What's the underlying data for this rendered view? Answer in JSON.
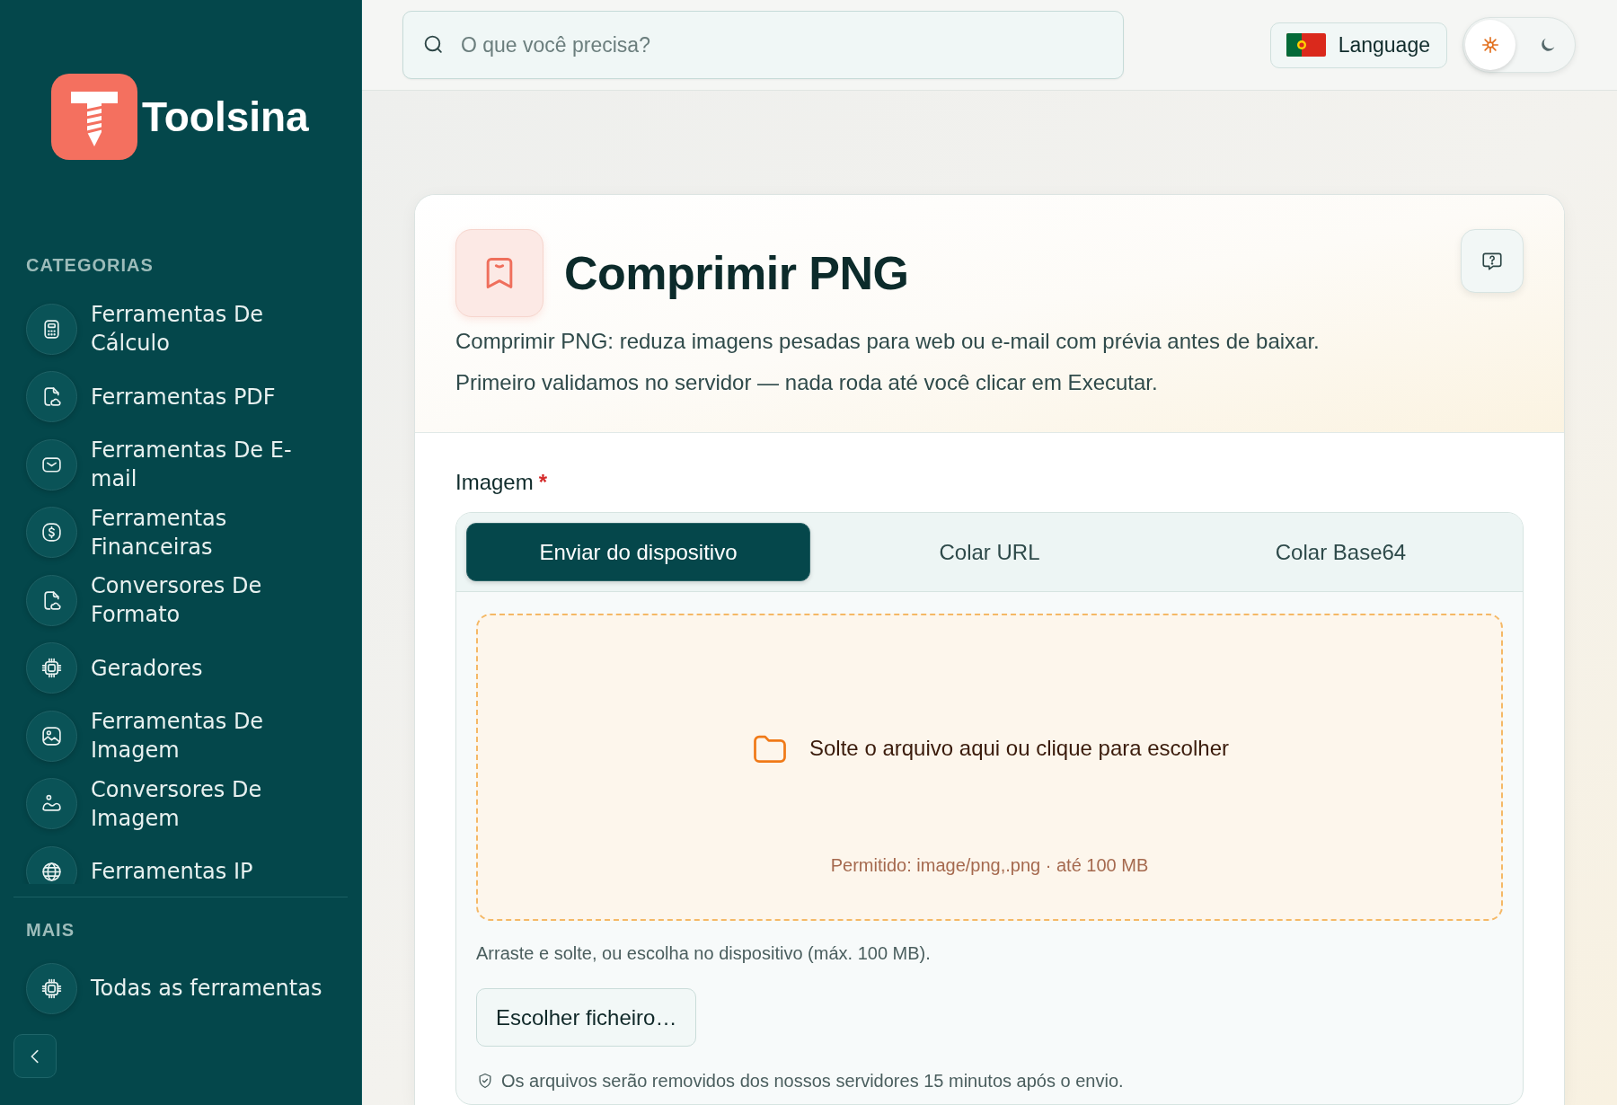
{
  "sidebar": {
    "logo": {
      "text": "Toolsina"
    },
    "categories": {
      "title": "CATEGORIAS",
      "items": [
        {
          "label": "Ferramentas De Cálculo"
        },
        {
          "label": "Ferramentas PDF"
        },
        {
          "label": "Ferramentas De E-mail"
        },
        {
          "label": "Ferramentas Financeiras"
        },
        {
          "label": "Conversores De Formato"
        },
        {
          "label": "Geradores"
        },
        {
          "label": "Ferramentas De Imagem"
        },
        {
          "label": "Conversores De Imagem"
        },
        {
          "label": "Ferramentas IP"
        }
      ]
    },
    "more": {
      "title": "MAIS",
      "items": [
        {
          "label": "Todas as ferramentas"
        }
      ]
    }
  },
  "top_bar": {
    "search": {
      "placeholder": "O que você precisa?"
    },
    "language": {
      "label": "Language"
    },
    "theme_toggle": {
      "options": [
        {
          "selected": true
        },
        {
          "selected": false
        }
      ]
    }
  },
  "tool": {
    "title": "Comprimir PNG",
    "description": [
      "Comprimir PNG: reduza imagens pesadas para web ou e-mail com prévia antes de baixar.",
      "Primeiro validamos no servidor — nada roda até você clicar em Executar."
    ],
    "field": {
      "label": "Imagem",
      "required_mark": "*",
      "tabs": [
        {
          "label": "Enviar do dispositivo",
          "selected": true
        },
        {
          "label": "Colar URL",
          "selected": false
        },
        {
          "label": "Colar Base64",
          "selected": false
        }
      ],
      "dropzone": {
        "prompt": "Solte o arquivo aqui ou clique para escolher",
        "allowed": "Permitido: image/png,.png · até 100 MB"
      },
      "hint": "Arraste e solte, ou escolha no dispositivo (máx. 100 MB).",
      "button": "Escolher ficheiro…",
      "notice": "Os arquivos serão removidos dos nossos servidores 15 minutos após o envio."
    }
  }
}
